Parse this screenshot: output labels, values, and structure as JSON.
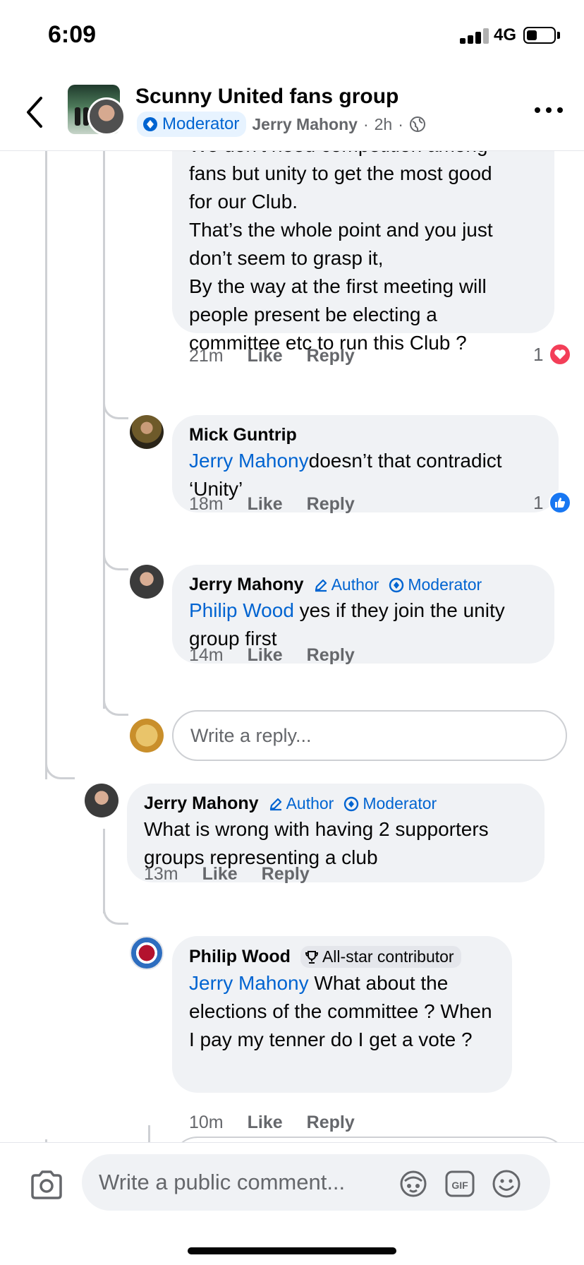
{
  "status_bar": {
    "time": "6:09",
    "network": "4G"
  },
  "header": {
    "group_name": "Scunny United fans group",
    "moderator_label": "Moderator",
    "poster": "Jerry Mahony",
    "separator": "·",
    "time": "2h"
  },
  "comments": [
    {
      "text_lines": [
        "We don't need competition among",
        "fans but unity to get the most good",
        "for our Club.",
        "That’s the whole point and you just",
        "don’t seem to grasp it,",
        "By the way at the first meeting will",
        "people present be electing a",
        "committee etc to run this Club ?"
      ],
      "time": "21m",
      "like": "Like",
      "reply": "Reply",
      "reaction_count": "1",
      "reaction_type": "love"
    },
    {
      "author": "Mick Guntrip",
      "mention": "Jerry Mahony",
      "text": "doesn’t that contradict ‘Unity’",
      "time": "18m",
      "like": "Like",
      "reply": "Reply",
      "reaction_count": "1",
      "reaction_type": "like"
    },
    {
      "author": "Jerry Mahony",
      "badges": [
        "Author",
        "Moderator"
      ],
      "mention": "Philip Wood",
      "text": " yes if they join the unity group first",
      "time": "14m",
      "like": "Like",
      "reply": "Reply"
    },
    {
      "author": "Jerry Mahony",
      "badges": [
        "Author",
        "Moderator"
      ],
      "text": "What is wrong with having 2 supporters groups representing a club",
      "time": "13m",
      "like": "Like",
      "reply": "Reply"
    },
    {
      "author": "Philip Wood",
      "badge": "All-star contributor",
      "mention": "Jerry Mahony",
      "text": " What about the elections of the committee ? When I pay my tenner do I get a vote ?",
      "time": "10m",
      "like": "Like",
      "reply": "Reply"
    }
  ],
  "reply_box": {
    "placeholder": "Write a reply..."
  },
  "comment_box": {
    "placeholder": "Write a public comment..."
  },
  "colors": {
    "accent": "#0064d1",
    "like_blue": "#1877f2",
    "love_red": "#f33e58",
    "bubble": "#f0f2f5"
  }
}
